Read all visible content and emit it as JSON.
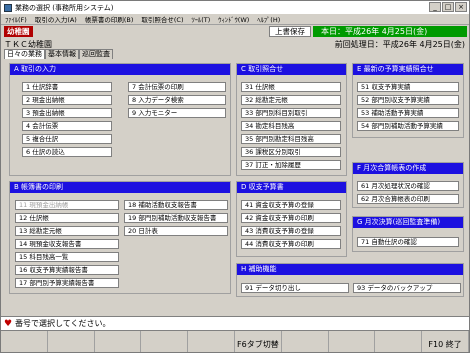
{
  "window": {
    "title": "業務の選択 (事務所用システム)",
    "min": "_",
    "max": "□",
    "close": "×"
  },
  "menu": [
    "ﾌｧｲﾙ(F)",
    "取引の入力(A)",
    "帳票書の印刷(B)",
    "取引照合せ(C)",
    "ﾂｰﾙ(T)",
    "ｳｨﾝﾄﾞｳ(W)",
    "ﾍﾙﾌﾟ(H)"
  ],
  "header": {
    "badge": "幼稚園",
    "save": "上書保存",
    "today": "本日：平成26年 4月25日(金)",
    "company": "ＴＫＣ幼稚園",
    "prev_date": "前回処理日：平成26年 4月25日(金)"
  },
  "tabs": [
    "日々の業務",
    "基本情報",
    "巡回監査"
  ],
  "panels": {
    "a": {
      "title": "A  取引の入力",
      "col1": [
        "1 仕訳辞書",
        "2 現金出納帳",
        "3 預金出納帳",
        "4 会計伝票",
        "5 複合仕訳",
        "6 仕訳の読込"
      ],
      "col2": [
        "7 会計伝票の印刷",
        "8 入力データ検索",
        "9 入力モニター"
      ]
    },
    "b": {
      "title": "B  帳簿書の印刷",
      "col1": [
        "11 現預金出納帳",
        "12 仕訳帳",
        "13 総勘定元帳",
        "14 現預金収支報告書",
        "15 科目残高一覧",
        "16 収支予算実績報告書",
        "17 部門別予算実績報告書"
      ],
      "col2": [
        "18 補助活動収支報告書",
        "19 部門別補助活動収支報告書",
        "20 日計表"
      ]
    },
    "c": {
      "title": "C  取引照合せ",
      "items": [
        "31 仕訳帳",
        "32 総勘定元帳",
        "33 部門別科目別取引",
        "34 勘定科目残高",
        "35 部門別勘定科目残高",
        "36 課税区分別取引",
        "37 訂正・加除履歴"
      ]
    },
    "d": {
      "title": "D  収支予算書",
      "items": [
        "41 資金収支予算の登録",
        "42 資金収支予算の印刷",
        "43 消費収支予算の登録",
        "44 消費収支予算の印刷"
      ]
    },
    "e": {
      "title": "E  最新の予算実績照合せ",
      "items": [
        "51 収支予算実績",
        "52 部門別収支予算実績",
        "53 補助活動予算実績",
        "54 部門別補助活動予算実績"
      ]
    },
    "f": {
      "title": "F  月次合算帳表の作成",
      "items": [
        "61 月次処理状況の確認",
        "62 月次合算帳表の印刷"
      ]
    },
    "g": {
      "title": "G  月次決算(巡回監査準備)",
      "items": [
        "71 自動仕訳の確認"
      ]
    },
    "h": {
      "title": "H  補助機能",
      "items": [
        "91 データ切り出し",
        "93 データのバックアップ"
      ]
    }
  },
  "status": {
    "icon": "heart-icon",
    "text": "番号で選択してください。"
  },
  "fkeys": [
    "",
    "",
    "",
    "",
    "",
    "F6タブ切替",
    "",
    "",
    "",
    "F10 終了"
  ]
}
